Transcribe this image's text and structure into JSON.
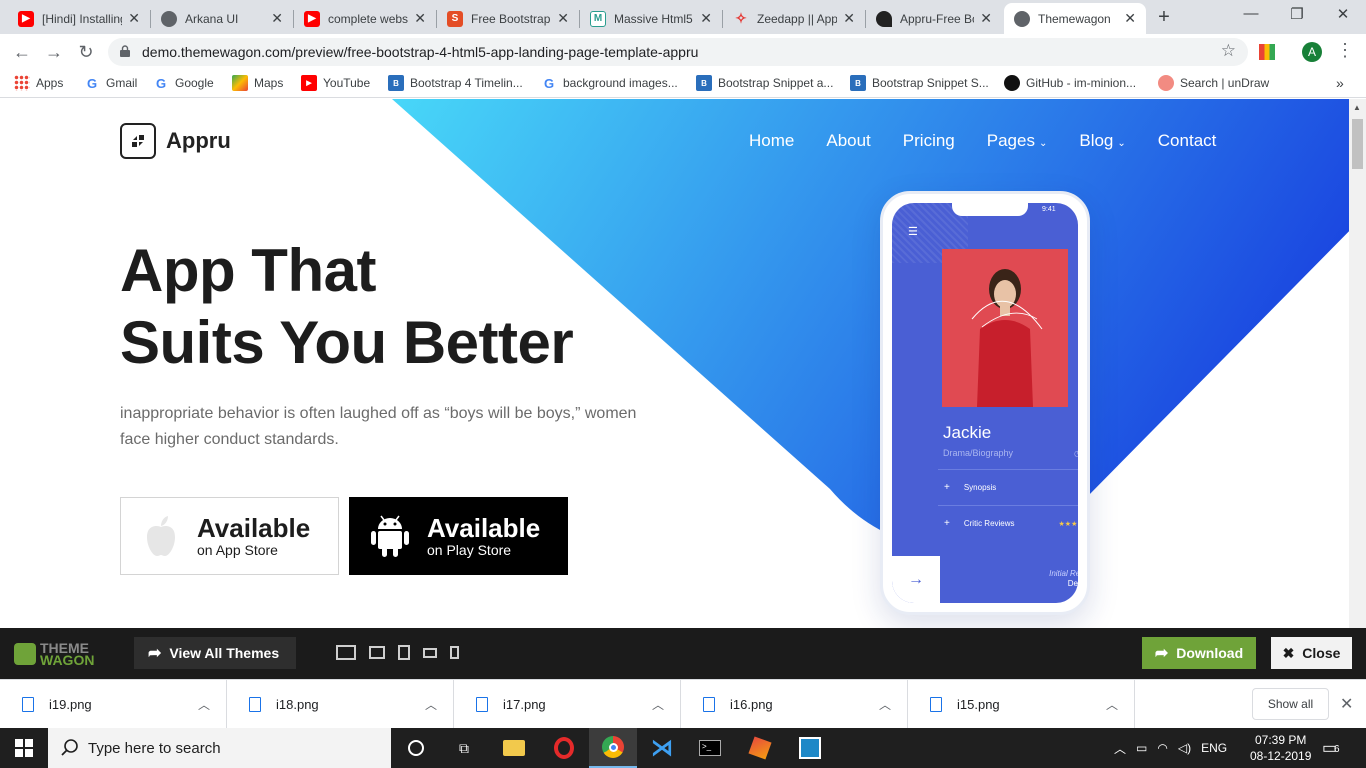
{
  "tabs": [
    {
      "title": "[Hindi] Installing",
      "icon": "youtube-icon"
    },
    {
      "title": "Arkana UI",
      "icon": "globe-icon"
    },
    {
      "title": "complete website",
      "icon": "youtube-icon"
    },
    {
      "title": "Free Bootstrap",
      "icon": "s-icon"
    },
    {
      "title": "Massive Html5",
      "icon": "massive-icon"
    },
    {
      "title": "Zeedapp || App",
      "icon": "zeedapp-icon"
    },
    {
      "title": "Appru-Free Bo",
      "icon": "appru-icon"
    },
    {
      "title": "Themewagon",
      "icon": "globe-icon"
    }
  ],
  "address": {
    "url": "demo.themewagon.com/preview/free-bootstrap-4-html5-app-landing-page-template-appru"
  },
  "profile_initial": "A",
  "bookmarks": [
    {
      "label": "Apps"
    },
    {
      "label": "Gmail"
    },
    {
      "label": "Google"
    },
    {
      "label": "Maps"
    },
    {
      "label": "YouTube"
    },
    {
      "label": "Bootstrap 4 Timelin..."
    },
    {
      "label": "background images..."
    },
    {
      "label": "Bootstrap Snippet a..."
    },
    {
      "label": "Bootstrap Snippet S..."
    },
    {
      "label": "GitHub - im-minion..."
    },
    {
      "label": "Search | unDraw"
    }
  ],
  "site": {
    "logo": "Appru",
    "nav": [
      "Home",
      "About",
      "Pricing",
      "Pages",
      "Blog",
      "Contact"
    ],
    "hero_line1": "App That",
    "hero_line2": "Suits You Better",
    "hero_text": "inappropriate behavior is often laughed off as “boys will be boys,” women face higher conduct standards.",
    "apple_big": "Available",
    "apple_small": "on App Store",
    "play_big": "Available",
    "play_small": "on Play Store",
    "phone": {
      "time": "9:41",
      "movie_title": "Jackie",
      "genre": "Drama/Biography",
      "row1": "Synopsis",
      "row2": "Critic Reviews",
      "foot1": "Initial Rel",
      "foot2": "Dec"
    },
    "gradient_from": "#48d7f8",
    "gradient_to": "#1a45e0"
  },
  "themewagon": {
    "logo_line1": "THEME",
    "logo_line2": "WAGON",
    "view_all": "View All Themes",
    "download": "Download",
    "close": "Close"
  },
  "downloads": [
    {
      "file": "i19.png"
    },
    {
      "file": "i18.png"
    },
    {
      "file": "i17.png"
    },
    {
      "file": "i16.png"
    },
    {
      "file": "i15.png"
    }
  ],
  "show_all": "Show all",
  "taskbar": {
    "search_placeholder": "Type here to search",
    "lang": "ENG",
    "time": "07:39 PM",
    "date": "08-12-2019",
    "notif_count": "6"
  }
}
